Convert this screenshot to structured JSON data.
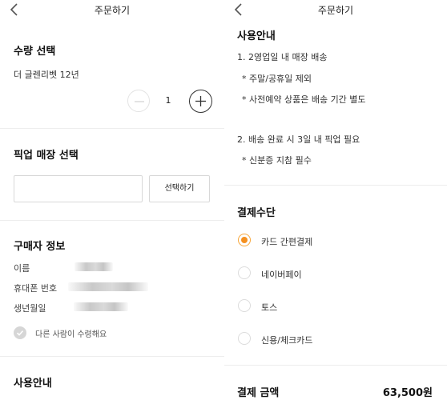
{
  "left": {
    "header": {
      "title": "주문하기"
    },
    "quantity": {
      "title": "수량 선택",
      "product_name": "더 글렌리벳 12년",
      "value": "1"
    },
    "pickup": {
      "title": "픽업 매장 선택",
      "store_value": "",
      "select_button": "선택하기"
    },
    "buyer": {
      "title": "구매자 정보",
      "name_label": "이름",
      "phone_label": "휴대폰 번호",
      "birth_label": "생년월일",
      "other_receiver_label": "다른 사람이 수령해요"
    },
    "usage_title": "사용안내"
  },
  "right": {
    "header": {
      "title": "주문하기"
    },
    "usage": {
      "title": "사용안내",
      "lines": [
        "1. 2영업일 내 매장 배송",
        "* 주말/공휴일 제외",
        "* 사전예약 상품은 배송 기간 별도",
        "2. 배송 완료 시 3일 내 픽업 필요",
        "* 신분증 지참 필수"
      ]
    },
    "payment": {
      "title": "결제수단",
      "options": [
        "카드 간편결제",
        "네이버페이",
        "토스",
        "신용/체크카드"
      ],
      "selected_index": 0,
      "accent_color": "#f5901f"
    },
    "amount": {
      "label": "결제 금액",
      "value": "63,500원"
    }
  }
}
